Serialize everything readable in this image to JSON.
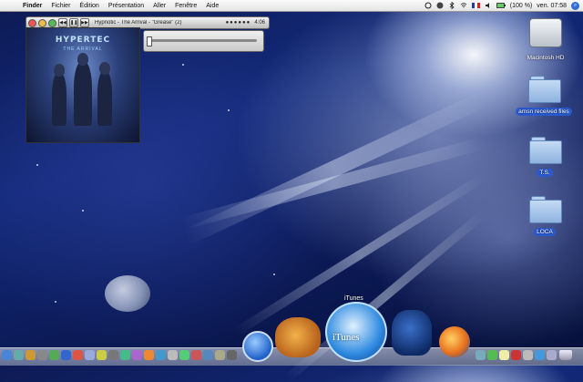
{
  "menubar": {
    "app": "Finder",
    "items": [
      "Fichier",
      "Édition",
      "Présentation",
      "Aller",
      "Fenêtre",
      "Aide"
    ],
    "battery": "(100 %)",
    "clock": "ven. 07:58"
  },
  "player": {
    "track": "Hypnotic - The Arrival - \"Grease\" (2)",
    "time": "4:06"
  },
  "artwork": {
    "band": "HYPERTEC",
    "album": "THE ARRIVAL"
  },
  "desktop": {
    "icons": [
      {
        "label": "Macintosh HD",
        "selected": false
      },
      {
        "label": "amsn received files",
        "selected": true
      },
      {
        "label": "T.S.",
        "selected": true
      },
      {
        "label": "LOCA",
        "selected": true
      }
    ]
  },
  "dock": {
    "tooltip": "iTunes",
    "itunes_label": "iTunes"
  },
  "colors": {
    "selection": "#2a5bd2",
    "spotlight": "#2f6fd6"
  }
}
